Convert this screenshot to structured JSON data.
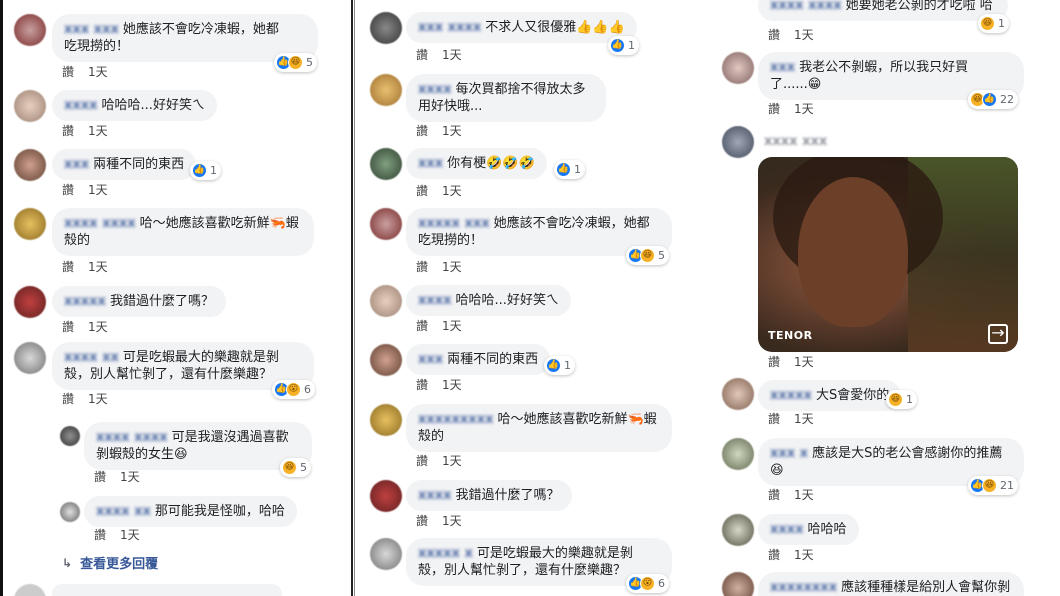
{
  "labels": {
    "like": "讚",
    "time": "1天",
    "view_more": "查看更多回覆",
    "tenor": "TENOR"
  },
  "col1": [
    {
      "name": "xxx xxx",
      "text": "她應該不會吃冷凍蝦，她都\n吃現撈的！",
      "react": [
        "like",
        "haha"
      ],
      "count": "5"
    },
    {
      "name": "xxxx",
      "text": "哈哈哈...好好笑ㄟ",
      "react": [],
      "count": ""
    },
    {
      "name": "xxx",
      "text": "兩種不同的東西",
      "react": [
        "like"
      ],
      "count": "1"
    },
    {
      "name": "xxxx xxxx",
      "text": "哈～她應該喜歡吃新鮮🦐蝦\n殼的",
      "react": [],
      "count": ""
    },
    {
      "name": "xxxxx",
      "text": "我錯過什麼了嗎？",
      "react": [],
      "count": ""
    },
    {
      "name": "xxxx xx",
      "text": "可是吃蝦最大的樂趣就是剝\n殼，別人幫忙剝了，還有什麼樂趣？",
      "react": [
        "like",
        "wow"
      ],
      "count": "6"
    },
    {
      "name": "xxxx xxxx",
      "text": "可是我還沒遇過喜歡\n剝蝦殼的女生😆",
      "react": [
        "haha"
      ],
      "count": "5"
    },
    {
      "name": "xxxx xx",
      "text": "那可能我是怪咖，哈哈",
      "react": [],
      "count": ""
    }
  ],
  "col2": [
    {
      "name": "xxx xxxx",
      "text": "不求人又很優雅👍👍👍",
      "react": [
        "like"
      ],
      "count": "1"
    },
    {
      "name": "xxxx",
      "text": "每次買都捨不得放太多\n用好快哦...",
      "react": [],
      "count": ""
    },
    {
      "name": "xxx",
      "text": "你有梗🤣🤣🤣",
      "react": [
        "like"
      ],
      "count": "1"
    },
    {
      "name": "xxxxx xxx",
      "text": "她應該不會吃冷凍蝦，她都\n吃現撈的！",
      "react": [
        "like",
        "haha"
      ],
      "count": "5"
    },
    {
      "name": "xxxx",
      "text": "哈哈哈...好好笑ㄟ",
      "react": [],
      "count": ""
    },
    {
      "name": "xxx",
      "text": "兩種不同的東西",
      "react": [
        "like"
      ],
      "count": "1"
    },
    {
      "name": "xxxxxxxxx",
      "text": "哈～她應該喜歡吃新鮮🦐蝦\n殼的",
      "react": [],
      "count": ""
    },
    {
      "name": "xxxx",
      "text": "我錯過什麼了嗎？",
      "react": [],
      "count": ""
    },
    {
      "name": "xxxxx x",
      "text": "可是吃蝦最大的樂趣就是剝\n殼，別人幫忙剝了，還有什麼樂趣？",
      "react": [
        "like",
        "wow"
      ],
      "count": "6"
    }
  ],
  "col3": [
    {
      "name": "xxxx xxxx",
      "text": "她要她老公剝的才吃啦 哈",
      "react": [
        "haha"
      ],
      "count": "1"
    },
    {
      "name": "xxx",
      "text": "我老公不剝蝦，所以我只好買\n了......😁",
      "react": [
        "haha",
        "like"
      ],
      "count": "22"
    },
    {
      "name": "xxxx xxx",
      "text": "",
      "react": [],
      "count": ""
    },
    {
      "name": "xxxxx",
      "text": "大S會愛你的",
      "react": [
        "haha"
      ],
      "count": "1"
    },
    {
      "name": "xxx x",
      "text": "應該是大S的老公會感謝你的推薦\n😆",
      "react": [
        "like",
        "haha"
      ],
      "count": "21"
    },
    {
      "name": "xxxx",
      "text": "哈哈哈",
      "react": [],
      "count": ""
    },
    {
      "name": "xxxxxxxx",
      "text": "應該種種樣是給別人會幫你剝的",
      "react": [],
      "count": ""
    }
  ],
  "colors": {
    "bubble": "#f2f3f5",
    "link": "#385898",
    "like": "#1877f2",
    "haha": "#f7b125"
  }
}
